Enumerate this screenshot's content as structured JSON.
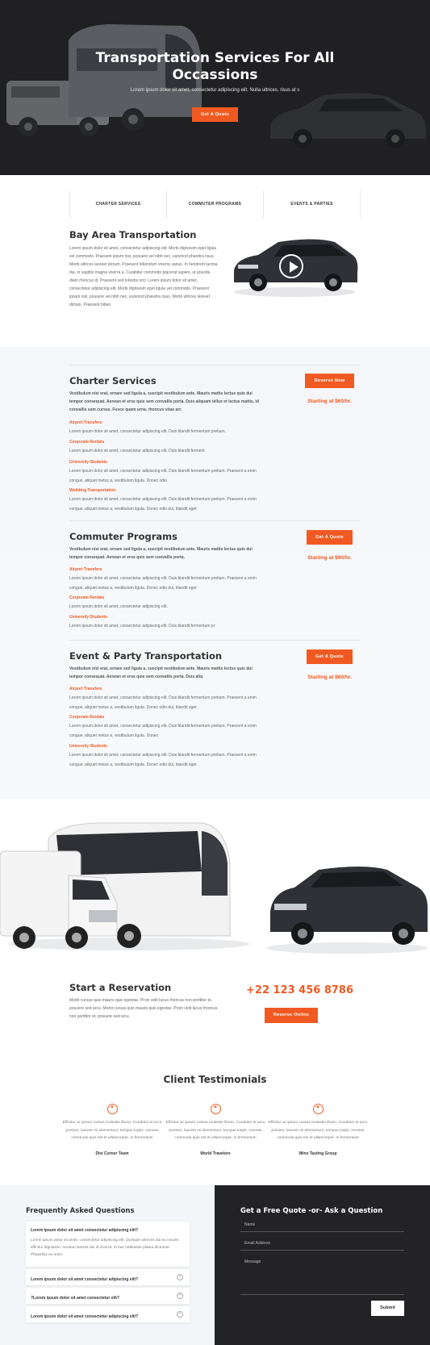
{
  "hero": {
    "title_line1": "Transportation Services For All",
    "title_line2": "Occassions",
    "subtitle": "Lorem ipsum dolor sit amet, consectetur adipiscing elit. Nulla ultrices, risus at s",
    "cta": "Get A Quote"
  },
  "tabs": [
    "CHARTER SERVICES",
    "COMMUTER PROGRAMS",
    "EVENTS & PARTIES"
  ],
  "bay": {
    "title": "Bay Area Transportation",
    "text": "Lorem ipsum dolor sit amet, consectetur adipiscing elit. Morbi dignissim eget ligula vel commodo. Praesent ipsum nisl, posuere vel nibh nec, euismod pharetra risus. Morbi ultrices laoreet dictum. Praesent bibendum viverra varius. In hendrerit lacinia dui, in sagittis magna viverra a. Curabitur commodo placerat sapien, ut gravida diam rhoncus id. Praesent sed lobortis orci. Lorem ipsum dolor sit amet, consectetur adipiscing elit. Morbi dignissim eget ligula vel commodo. Praesent ipsum nisl, posuere vel nibh nec, euismod pharetra risus. Morbi ultrices laoreet dictum. Praesent biben"
  },
  "services": [
    {
      "title": "Charter Services",
      "lead": "Vestibulum nisi erat, ornare sed ligula a, suscipit vestibulum ante. Mauris mattis lectus quis dui tempor consequat. Aenean et eros quis sem convallis porta. Duis aliquam tellus et lectus mattis, id convallis sem cursus. Fusce quam urna, rhoncus vitae arc",
      "button": "Reserve Now",
      "price": "Starting at $60/hr.",
      "items": [
        {
          "label": "Airport Transfers",
          "text": "Lorem ipsum dolor sit amet, consectetur adipiscing elit. Duis blandit fermentum pretium."
        },
        {
          "label": "Corporate Rentals",
          "text": "Lorem ipsum dolor sit amet, consectetur adipiscing elit. Duis blandit ferment"
        },
        {
          "label": "University Students",
          "text": "Lorem ipsum dolor sit amet, consectetur adipiscing elit. Duis blandit fermentum pretium. Praesent a enim congue, aliquet metus a, vestibulum ligula. Donec odio"
        },
        {
          "label": "Wedding Transportation",
          "text": "Lorem ipsum dolor sit amet, consectetur adipiscing elit. Duis blandit fermentum pretium. Praesent a enim congue, aliquet metus a, vestibulum ligula. Donec odio dui, blandit eget"
        }
      ]
    },
    {
      "title": "Commuter Programs",
      "lead": "Vestibulum nisi erat, ornare sed ligula a, suscipit vestibulum ante. Mauris mattis lectus quis dui tempor consequat. Aenean et eros quis sem convallis porta.",
      "button": "Get A Quote",
      "price": "Starting at $60/hr.",
      "items": [
        {
          "label": "Airport Transfers",
          "text": "Lorem ipsum dolor sit amet, consectetur adipiscing elit. Duis blandit fermentum pretium. Praesent a enim congue, aliquet metus a, vestibulum ligula. Donec odio dui, blandit eget"
        },
        {
          "label": "Corporate Rentals",
          "text": "Lorem ipsum dolor sit amet, consectetur adipiscing elit."
        },
        {
          "label": "University Students",
          "text": "Lorem ipsum dolor sit amet, consectetur adipiscing elit. Duis blandit fermentum pr"
        }
      ]
    },
    {
      "title": "Event & Party Transportation",
      "lead": "Vestibulum nisi erat, ornare sed ligula a, suscipit vestibulum ante. Mauris mattis lectus quis dui tempor consequat. Aenean et eros quis sem convallis porta. Duis aliq",
      "button": "Get A Quote",
      "price": "Starting at $60/hr.",
      "items": [
        {
          "label": "Airport Transfers",
          "text": "Lorem ipsum dolor sit amet, consectetur adipiscing elit. Duis blandit fermentum pretium. Praesent a enim congue, aliquet metus a, vestibulum ligula. Donec odio dui, blandit eget"
        },
        {
          "label": "Corporate Rentals",
          "text": "Lorem ipsum dolor sit amet, consectetur adipiscing elit. Duis blandit fermentum pretium. Praesent a enim congue, aliquet metus a, vestibulum ligula. Donec"
        },
        {
          "label": "University Students",
          "text": "Lorem ipsum dolor sit amet, consectetur adipiscing elit. Duis blandit fermentum pretium. Praesent a enim congue, aliquet metus a, vestibulum ligula. Donec odio dui, blandit eget"
        }
      ]
    }
  ],
  "reservation": {
    "title": "Start a Reservation",
    "text": "Morbi cursus quis mauris quis egestas. Proin velit lacus rhoncus non porttitor et, posuere sed arcu. Morbi cursus quis mauris quis egestas. Proin velit lacus rhoncus non porttitor et, posuere sed arcu.",
    "phone": "+22 123 456 8786",
    "button": "Reserve Online"
  },
  "testimonials": {
    "title": "Client Testimonials",
    "items": [
      {
        "text": "Efficitur ac ipsum cursus molestie libero. Curabitur et arcu pretium, laoreet mi elementum, tempus turpis. Aenean commodo quis est et ullamcorper. In fermentum",
        "name": "Divi Corner Team"
      },
      {
        "text": "Efficitur ac ipsum cursus molestie libero. Curabitur et arcu pretium, laoreet mi elementum, tempus turpis. Aenean commodo quis est et ullamcorper. In fermentum",
        "name": "World Travelers"
      },
      {
        "text": "Efficitur ac ipsum cursus molestie libero. Curabitur et arcu pretium, laoreet mi elementum, tempus turpis. Aenean commodo quis est et ullamcorper. In fermentum",
        "name": "Wine Tasting Group"
      }
    ]
  },
  "faq": {
    "title": "Frequently Asked Questions",
    "open_question": "Lorem ipsum dolor sit amet consectetur adipiscing elit?",
    "open_answer": "Lorem ipsum dolor sit amet, consectetur adipiscing elit. Quisque ultricies dui eu mauris efficitur dignissim. Aenean laoreet dui id viverra. In hac habitasse platea dictumst. Phasellus ex enim.",
    "questions": [
      "Lorem ipsum dolor sit amet consectetur adipiscing elit?",
      "?Lorem ipsum dolor sit amet consectetur elit?",
      "Lorem ipsum dolor sit amet consectetur adipiscing elit?"
    ]
  },
  "quote": {
    "title": "Get a Free Quote -or- Ask a Question",
    "name_placeholder": "Name",
    "email_placeholder": "Email Address",
    "message_placeholder": "Message",
    "submit": "Submit"
  }
}
